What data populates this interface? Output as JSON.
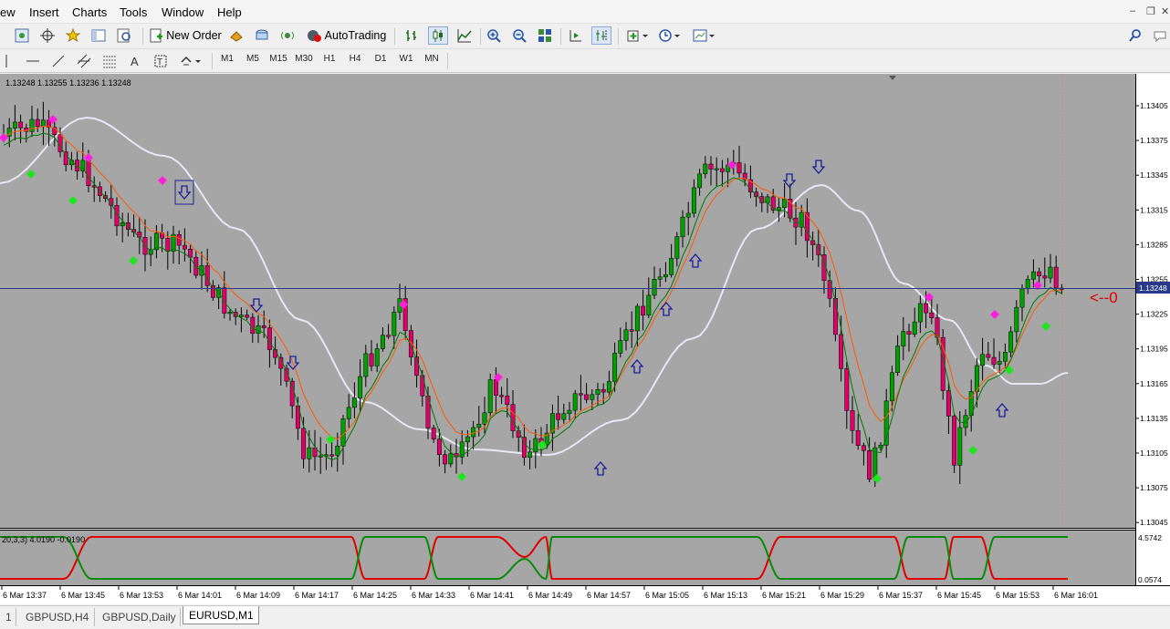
{
  "menu": {
    "items": [
      "ew",
      "Insert",
      "Charts",
      "Tools",
      "Window",
      "Help"
    ]
  },
  "toolbar": {
    "new_order_label": "New Order",
    "autotrading_label": "AutoTrading"
  },
  "timeframes": [
    "M1",
    "M5",
    "M15",
    "M30",
    "H1",
    "H4",
    "D1",
    "W1",
    "MN"
  ],
  "chart": {
    "info_line": "1.13248 1.13255 1.13236 1.13248",
    "price_labels": [
      "1.13405",
      "1.13375",
      "1.13345",
      "1.13315",
      "1.13285",
      "1.13255",
      "1.13225",
      "1.13195",
      "1.13165",
      "1.13135",
      "1.13105",
      "1.13075",
      "1.13045"
    ],
    "current_price": "1.13248",
    "arrow_label": "<--0",
    "time_labels": [
      "6 Mar 13:37",
      "6 Mar 13:45",
      "6 Mar 13:53",
      "6 Mar 14:01",
      "6 Mar 14:09",
      "6 Mar 14:17",
      "6 Mar 14:25",
      "6 Mar 14:33",
      "6 Mar 14:41",
      "6 Mar 14:49",
      "6 Mar 14:57",
      "6 Mar 15:05",
      "6 Mar 15:13",
      "6 Mar 15:21",
      "6 Mar 15:29",
      "6 Mar 15:37",
      "6 Mar 15:45",
      "6 Mar 15:53",
      "6 Mar 16:01"
    ],
    "colors": {
      "background": "#a6a6a6",
      "bull": "#00a000",
      "bear": "#e0006a",
      "white_ma": "#e8e8f4",
      "orange_ma": "#ff5a00",
      "green_ma": "#007a00",
      "marker_pink": "#ff1fdc",
      "marker_green": "#1ee61e",
      "arrow": "#1d1d9a",
      "current_line": "#2a3a8a",
      "red_label": "#e00000"
    }
  },
  "indicator": {
    "label": "20,3,3) 4.0190 -0.0190",
    "scale_top": "4.5742",
    "scale_bottom": "0.0574"
  },
  "tabs": [
    "1",
    "GBPUSD,H4",
    "GBPUSD,Daily",
    "EURUSD,M1"
  ],
  "active_tab": "EURUSD,M1"
}
